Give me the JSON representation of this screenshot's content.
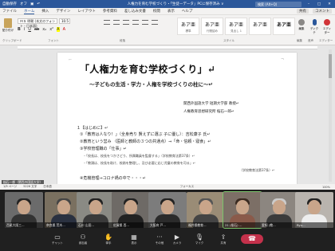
{
  "titlebar": {
    "autosave": "自動保存",
    "autosave_state": "オフ",
    "doc_title": "人権力を育む学校づくり・「生徒ーデータ」PCに保存済み ∨",
    "search_placeholder": "検索 (Alt+Q)"
  },
  "tabs": [
    "ファイル",
    "ホーム",
    "挿入",
    "デザイン",
    "レイアウト",
    "参考資料",
    "差し込み文書",
    "校閲",
    "表示",
    "ヘルプ"
  ],
  "tabs_right": {
    "share": "共有",
    "comment": "コメント"
  },
  "ribbon": {
    "paste_label": "貼り付け",
    "font_name": "ＭＳ 明朝 (本文のフォント - 日本語)",
    "font_size": "10.5",
    "format_buttons": [
      "B",
      "I",
      "U",
      "ab",
      "x₂",
      "x²",
      "A",
      "A"
    ],
    "styles": [
      {
        "sample": "あア亜",
        "name": "標準"
      },
      {
        "sample": "あア亜",
        "name": "行間詰め"
      },
      {
        "sample": "あア亜",
        "name": "見出し 1"
      },
      {
        "sample": "あア亜",
        "name": ""
      },
      {
        "sample": "あア亜",
        "name": ""
      }
    ],
    "tools": [
      "編集",
      "ディクテ",
      "エディター"
    ],
    "groups": [
      "クリップボード",
      "フォント",
      "段落",
      "スタイル",
      "編集",
      "音声",
      "エディター"
    ]
  },
  "document": {
    "title": "「人権力を育む学校づくり」↵",
    "subtitle": "～子どもの生活・学力・人権を学校づくりの柱に～↵",
    "author_affiliation": "関西外国語大学  短期大学部  教授↵",
    "author_name": "人権教育思想研究所  桜石一郎↵",
    "lines": [
      "１【はじめに】↵",
      "①「教育は人なり！」（全身売り  賢えずに選ぶ  子に優し）：吉松康子 氏↵",
      "②教育という営み   （医師と教師の３つの共通点）⇒「命・信頼・寝食」↵",
      "③学校管理職の「仕事」↵",
      "・「校長は、校長をつかさどり、所属職員を監督する」（学校教育法第37条）↵",
      "・「教頭は、校長を助け、校務を整理し、及び必要に応じ児童の教育を司る」↵",
      "（学校教育法第37条）↵",
      "④危機管理⇒コロナ禍の中で・・・↵"
    ]
  },
  "statusbar": {
    "page": "1/9 ページ",
    "words": "5226 文字",
    "lang": "日本語",
    "focus": "フォーカス",
    "zoom": "100%"
  },
  "participants": [
    "西尾大阪三...",
    "奈良県 荒木...",
    "石川 山田...",
    "佐賀県 西...",
    "大阪府 戸...",
    "福井県教育...",
    "21 (桜石) ...",
    "愛知 (教...",
    "Ryu..."
  ],
  "presenter_label": "桜石一郎（関西外国語大学）",
  "callbar": {
    "buttons": [
      "チャット",
      "参加者",
      "挙手",
      "表示",
      "その他",
      "カメラ",
      "マイク",
      "共有"
    ],
    "leave_icon": "phone-hangup"
  }
}
